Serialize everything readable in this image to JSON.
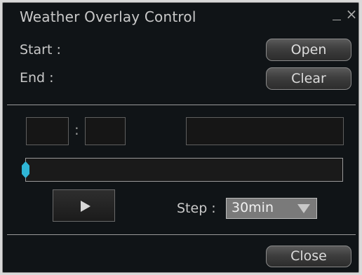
{
  "window": {
    "title": "Weather Overlay Control",
    "minimize_glyph": "_",
    "close_glyph": "×"
  },
  "fields": {
    "start_label": "Start :",
    "end_label": "End :"
  },
  "buttons": {
    "open": "Open",
    "clear": "Clear",
    "close": "Close"
  },
  "time": {
    "separator": ":",
    "hours": "",
    "minutes": "",
    "date": ""
  },
  "slider": {
    "position": 0,
    "thumb_color": "#2fb5d6"
  },
  "playback": {
    "play_icon": "play-icon",
    "step_label": "Step :",
    "step_value": "30min",
    "dropdown_icon": "chevron-down-icon"
  }
}
